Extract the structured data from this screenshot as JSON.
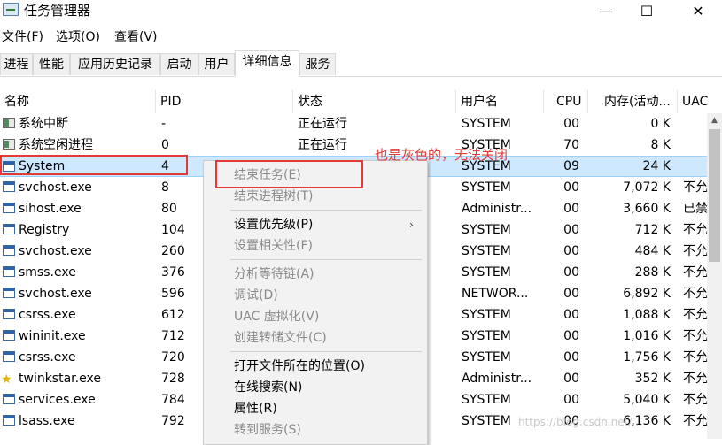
{
  "window": {
    "title": "任务管理器",
    "controls": [
      "—",
      "☐",
      "✕"
    ]
  },
  "menu": [
    "文件(F)",
    "选项(O)",
    "查看(V)"
  ],
  "tabs": [
    "进程",
    "性能",
    "应用历史记录",
    "启动",
    "用户",
    "详细信息",
    "服务"
  ],
  "active_tab": "详细信息",
  "columns": [
    "名称",
    "PID",
    "状态",
    "用户名",
    "CPU",
    "内存(活动...",
    "UAC"
  ],
  "rows": [
    {
      "icon": "gray-app-icon",
      "name": "系统中断",
      "pid": "-",
      "status": "正在运行",
      "user": "SYSTEM",
      "cpu": "00",
      "mem": "0 K",
      "uac": ""
    },
    {
      "icon": "gray-app-icon",
      "name": "系统空闲进程",
      "pid": "0",
      "status": "正在运行",
      "user": "SYSTEM",
      "cpu": "70",
      "mem": "8 K",
      "uac": ""
    },
    {
      "icon": "window-icon",
      "name": "System",
      "pid": "4",
      "status": "",
      "user": "SYSTEM",
      "cpu": "09",
      "mem": "24 K",
      "uac": ""
    },
    {
      "icon": "window-icon",
      "name": "svchost.exe",
      "pid": "8",
      "status": "",
      "user": "SYSTEM",
      "cpu": "00",
      "mem": "7,072 K",
      "uac": "不允"
    },
    {
      "icon": "window-icon",
      "name": "sihost.exe",
      "pid": "80",
      "status": "",
      "user": "Administr...",
      "cpu": "00",
      "mem": "3,660 K",
      "uac": "已禁"
    },
    {
      "icon": "window-icon",
      "name": "Registry",
      "pid": "104",
      "status": "",
      "user": "SYSTEM",
      "cpu": "00",
      "mem": "712 K",
      "uac": "不允"
    },
    {
      "icon": "window-icon",
      "name": "svchost.exe",
      "pid": "260",
      "status": "",
      "user": "SYSTEM",
      "cpu": "00",
      "mem": "484 K",
      "uac": "不允"
    },
    {
      "icon": "window-icon",
      "name": "smss.exe",
      "pid": "376",
      "status": "",
      "user": "SYSTEM",
      "cpu": "00",
      "mem": "288 K",
      "uac": "不允"
    },
    {
      "icon": "window-icon",
      "name": "svchost.exe",
      "pid": "596",
      "status": "",
      "user": "NETWOR...",
      "cpu": "00",
      "mem": "6,892 K",
      "uac": "不允"
    },
    {
      "icon": "window-icon",
      "name": "csrss.exe",
      "pid": "612",
      "status": "",
      "user": "SYSTEM",
      "cpu": "00",
      "mem": "1,088 K",
      "uac": "不允"
    },
    {
      "icon": "window-icon",
      "name": "wininit.exe",
      "pid": "712",
      "status": "",
      "user": "SYSTEM",
      "cpu": "00",
      "mem": "1,016 K",
      "uac": "不允"
    },
    {
      "icon": "window-icon",
      "name": "csrss.exe",
      "pid": "720",
      "status": "",
      "user": "SYSTEM",
      "cpu": "00",
      "mem": "1,756 K",
      "uac": "不允"
    },
    {
      "icon": "star-icon",
      "name": "twinkstar.exe",
      "pid": "728",
      "status": "",
      "user": "Administr...",
      "cpu": "00",
      "mem": "352 K",
      "uac": "不允"
    },
    {
      "icon": "window-icon",
      "name": "services.exe",
      "pid": "784",
      "status": "",
      "user": "SYSTEM",
      "cpu": "00",
      "mem": "5,040 K",
      "uac": "不允"
    },
    {
      "icon": "window-icon",
      "name": "lsass.exe",
      "pid": "792",
      "status": "",
      "user": "SYSTEM",
      "cpu": "00",
      "mem": "6,136 K",
      "uac": "不允"
    }
  ],
  "context_menu": [
    {
      "label": "结束任务(E)",
      "disabled": true
    },
    {
      "label": "结束进程树(T)",
      "disabled": true
    },
    {
      "separator": true
    },
    {
      "label": "设置优先级(P)",
      "disabled": false,
      "submenu": true
    },
    {
      "label": "设置相关性(F)",
      "disabled": true
    },
    {
      "separator": true
    },
    {
      "label": "分析等待链(A)",
      "disabled": true
    },
    {
      "label": "调试(D)",
      "disabled": true
    },
    {
      "label": "UAC 虚拟化(V)",
      "disabled": true
    },
    {
      "label": "创建转储文件(C)",
      "disabled": true
    },
    {
      "separator": true
    },
    {
      "label": "打开文件所在的位置(O)",
      "disabled": false
    },
    {
      "label": "在线搜索(N)",
      "disabled": false
    },
    {
      "label": "属性(R)",
      "disabled": false
    },
    {
      "label": "转到服务(S)",
      "disabled": true
    }
  ],
  "annotation": "也是灰色的，无法关闭",
  "watermark": "https://blog.csdn.net/...",
  "colors": {
    "annotation": "#e53935",
    "selection": "#cde8ff",
    "disabled_text": "#8a8a8a"
  }
}
